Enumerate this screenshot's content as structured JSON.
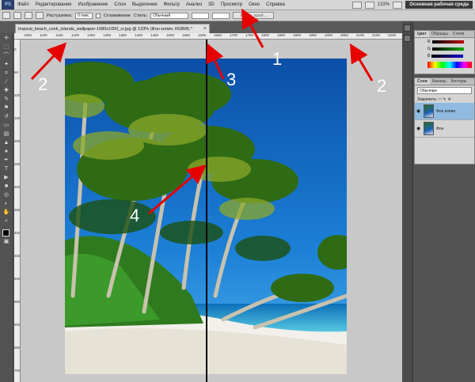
{
  "app": {
    "logo": "PS"
  },
  "menu": [
    "Файл",
    "Редактирование",
    "Изображение",
    "Слои",
    "Выделение",
    "Фильтр",
    "Анализ",
    "3D",
    "Просмотр",
    "Окно",
    "Справка"
  ],
  "topbar": {
    "zoom": "133%",
    "workspace": "Основная рабочая среда"
  },
  "options": {
    "feather_label": "Растушевка:",
    "feather_value": "0 пикс.",
    "antialias_label": "Сглаживание",
    "style_label": "Стиль:",
    "style_value": "Обычный",
    "refine_button": "Уточн. край..."
  },
  "document": {
    "tab_title": "tropical_beach_cook_islands_wallpaper-1680x1050_cr.jpg @ 133% (Фон копия, RGB/8) *"
  },
  "ruler_top": [
    "1050",
    "1100",
    "1150",
    "1200",
    "1250",
    "1300",
    "1350",
    "1400",
    "1450",
    "1500",
    "1550",
    "1600",
    "1650",
    "1700",
    "1750",
    "1800",
    "1850",
    "1900",
    "1950",
    "2000",
    "2050",
    "2100",
    "2150",
    "2200"
  ],
  "ruler_left": [
    "0",
    "50",
    "100",
    "150",
    "200",
    "250",
    "300",
    "350",
    "400",
    "450",
    "500",
    "550",
    "600",
    "650",
    "700"
  ],
  "panels": {
    "color_tabs": [
      "Цвет",
      "Образцы",
      "Стили"
    ],
    "color_channels": [
      "R",
      "G",
      "B"
    ],
    "layers_tabs": [
      "Слои",
      "Каналы",
      "Контуры"
    ],
    "blend_mode": "Обычные",
    "lock_label": "Закрепить:",
    "layers": [
      {
        "name": "Фон копия",
        "selected": true
      },
      {
        "name": "Фон",
        "selected": false
      }
    ]
  },
  "annotations": [
    "1",
    "2",
    "2",
    "3",
    "4"
  ],
  "colors": {
    "guide": "#000000",
    "annotation": "#e60000",
    "selected_layer": "#8fbbe0"
  }
}
